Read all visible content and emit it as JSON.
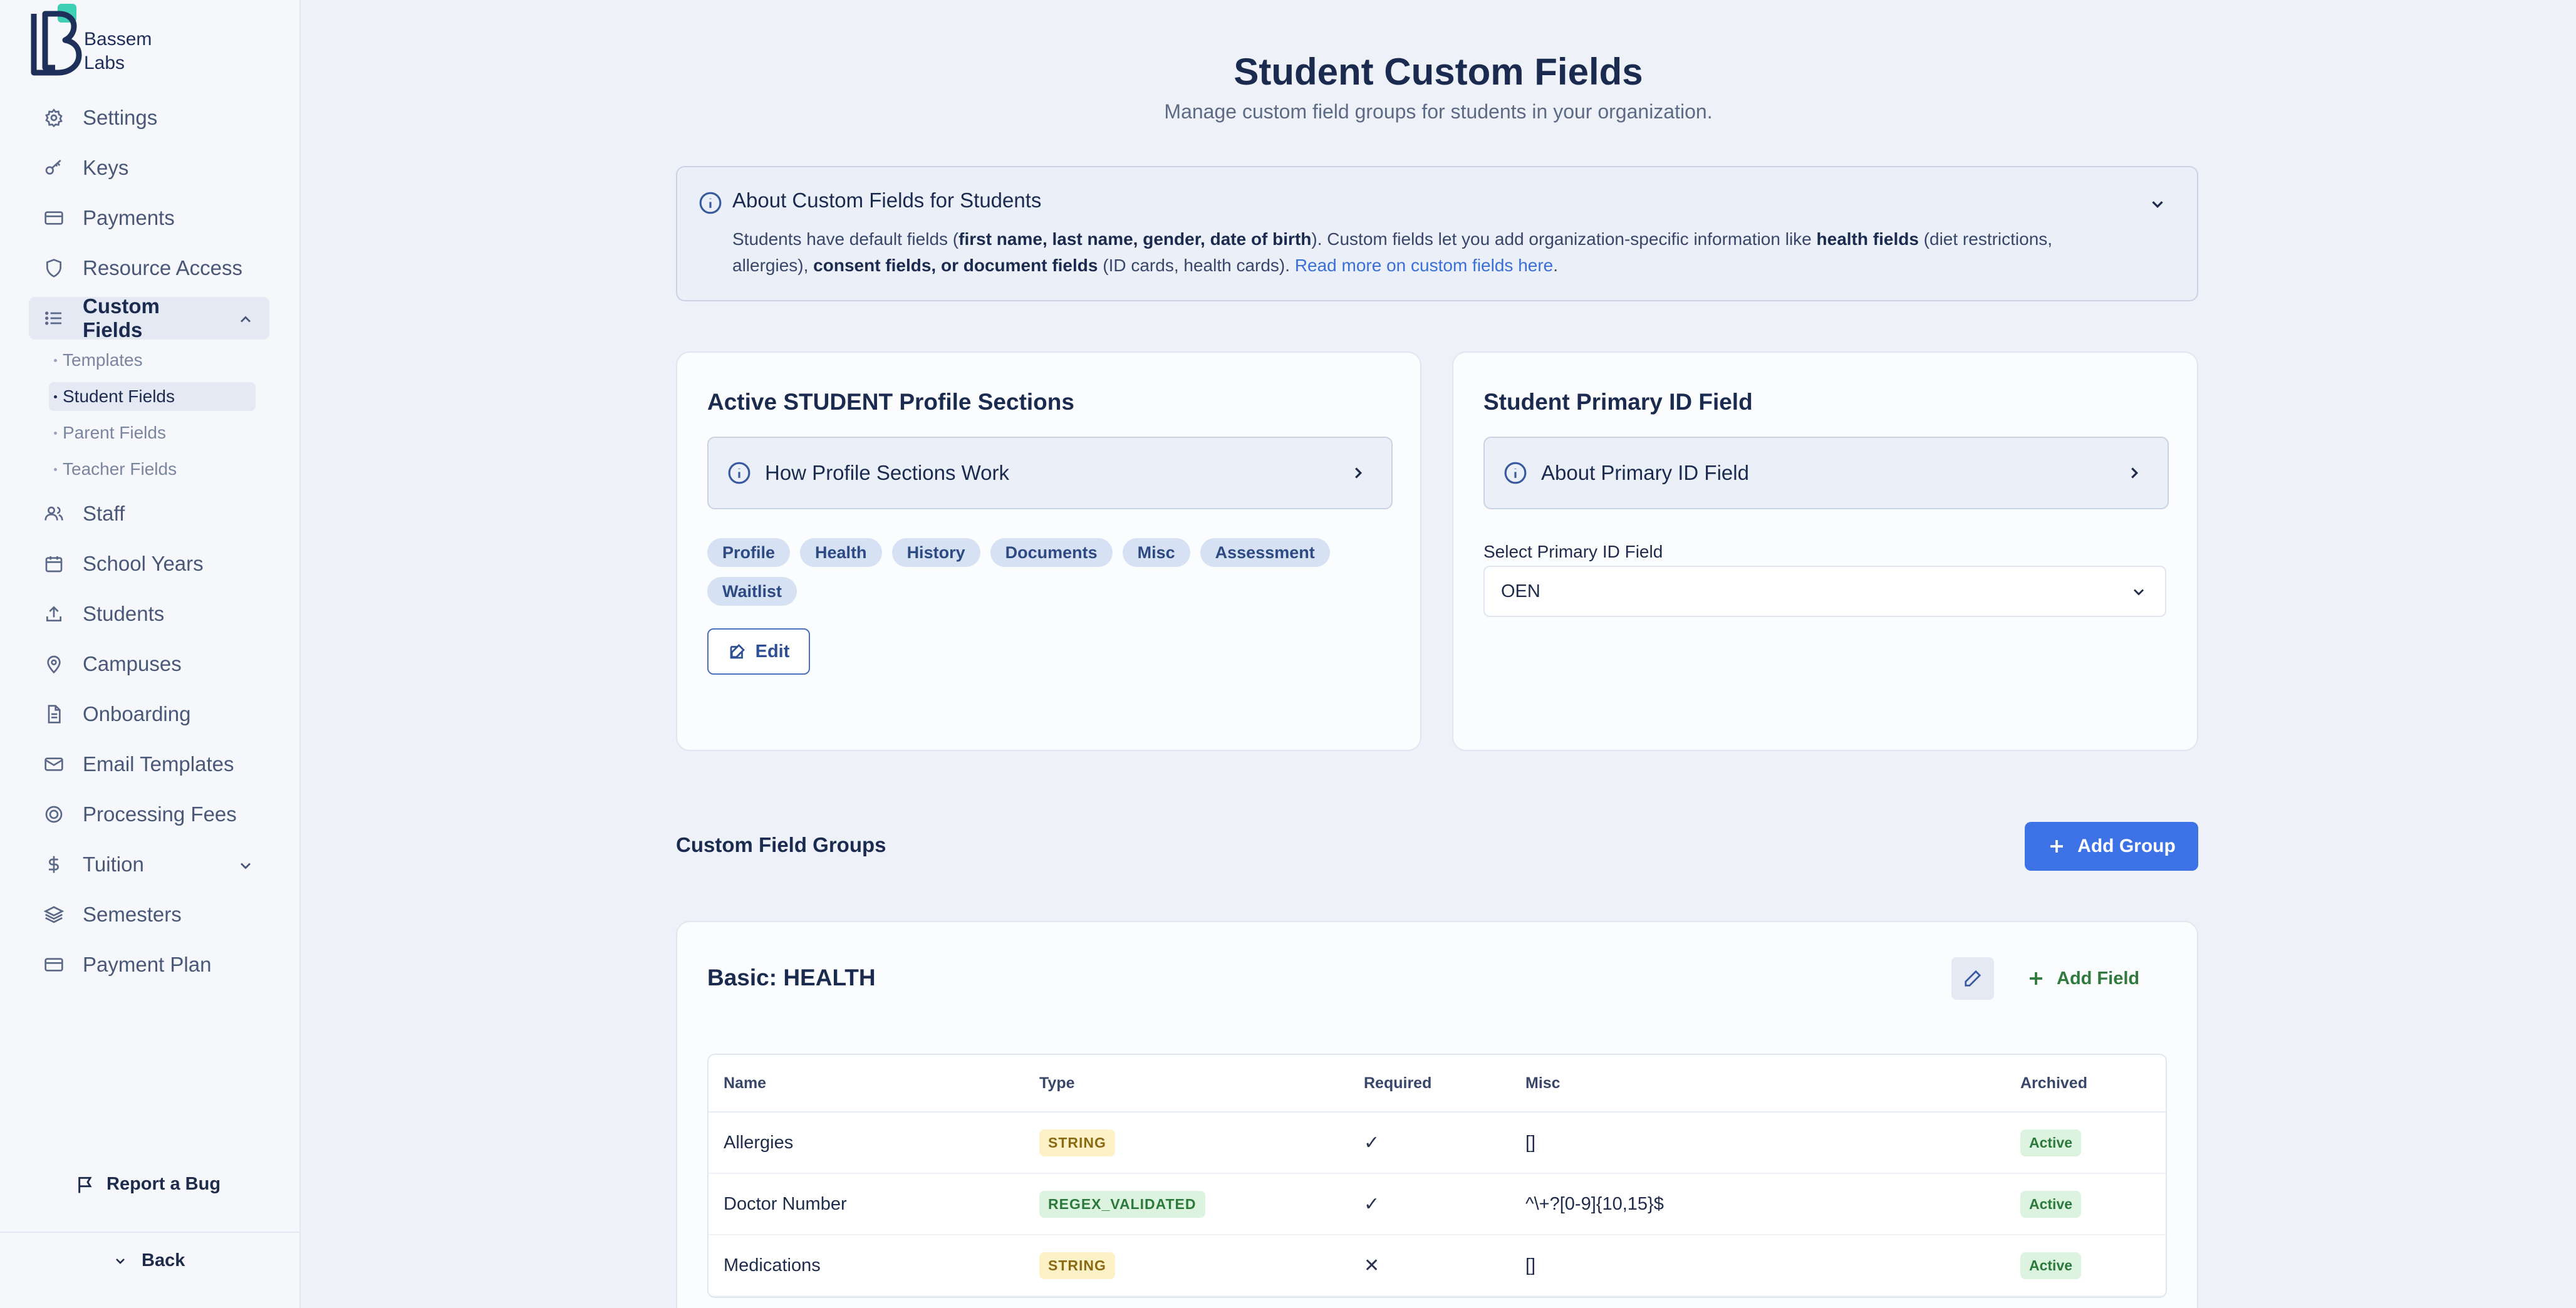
{
  "brand": {
    "name_line1": "Bassem",
    "name_line2": "Labs",
    "accent": "#3ecfb5"
  },
  "sidebar": {
    "items": [
      {
        "label": "Settings",
        "icon": "gear-icon"
      },
      {
        "label": "Keys",
        "icon": "key-icon"
      },
      {
        "label": "Payments",
        "icon": "credit-card-icon"
      },
      {
        "label": "Resource Access",
        "icon": "shield-icon"
      },
      {
        "label": "Custom Fields",
        "icon": "list-icon",
        "active": true,
        "expanded": true
      },
      {
        "label": "Staff",
        "icon": "users-icon"
      },
      {
        "label": "School Years",
        "icon": "calendar-icon"
      },
      {
        "label": "Students",
        "icon": "upload-icon"
      },
      {
        "label": "Campuses",
        "icon": "map-pin-icon"
      },
      {
        "label": "Onboarding",
        "icon": "document-icon"
      },
      {
        "label": "Email Templates",
        "icon": "mail-icon"
      },
      {
        "label": "Processing Fees",
        "icon": "coin-icon"
      },
      {
        "label": "Tuition",
        "icon": "dollar-icon",
        "has_chevron": true
      },
      {
        "label": "Semesters",
        "icon": "layers-icon"
      },
      {
        "label": "Payment Plan",
        "icon": "credit-card-icon"
      }
    ],
    "subitems": [
      {
        "label": "Templates"
      },
      {
        "label": "Student Fields",
        "active": true
      },
      {
        "label": "Parent Fields"
      },
      {
        "label": "Teacher Fields"
      }
    ],
    "report_bug": "Report a Bug",
    "back": "Back"
  },
  "header": {
    "title": "Student Custom Fields",
    "subtitle": "Manage custom field groups for students in your organization."
  },
  "about": {
    "title": "About Custom Fields for Students",
    "t1": "Students have default fields (",
    "b1": "first name, last name, gender, date of birth",
    "t2": "). Custom fields let you add organization-specific information like ",
    "b2": "health fields",
    "t3": " (diet restrictions, allergies), ",
    "b3": "consent fields, or document fields",
    "t4": " (ID cards, health cards). ",
    "link": "Read more on custom fields here",
    "t5": "."
  },
  "profile_sections": {
    "title": "Active STUDENT Profile Sections",
    "info_label": "How Profile Sections Work",
    "chips": [
      "Profile",
      "Health",
      "History",
      "Documents",
      "Misc",
      "Assessment",
      "Waitlist"
    ],
    "edit_label": "Edit"
  },
  "primary_id": {
    "title": "Student Primary ID Field",
    "info_label": "About Primary ID Field",
    "select_label": "Select Primary ID Field",
    "select_value": "OEN"
  },
  "groups": {
    "section_title": "Custom Field Groups",
    "add_group_label": "Add Group",
    "group": {
      "title": "Basic: HEALTH",
      "add_field_label": "Add Field",
      "columns": [
        "Name",
        "Type",
        "Required",
        "Misc",
        "Archived"
      ],
      "rows": [
        {
          "name": "Allergies",
          "type": "STRING",
          "required": "✓",
          "misc": "[]",
          "archived": "Active"
        },
        {
          "name": "Doctor Number",
          "type": "REGEX_VALIDATED",
          "required": "✓",
          "misc": "^\\+?[0-9]{10,15}$",
          "archived": "Active"
        },
        {
          "name": "Medications",
          "type": "STRING",
          "required": "✕",
          "misc": "[]",
          "archived": "Active"
        }
      ]
    }
  },
  "colors": {
    "primary": "#3d72e6",
    "success": "#2f7a3c",
    "string_badge": "#fdf1c7",
    "regex_badge": "#dcf3e0"
  }
}
